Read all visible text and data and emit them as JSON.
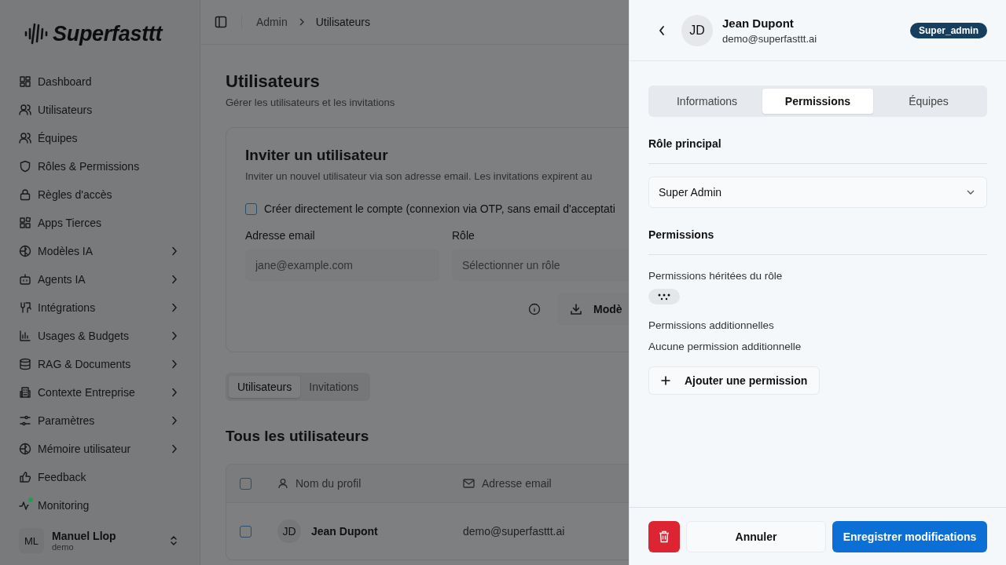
{
  "brand": {
    "name": "Superfasttt"
  },
  "sidebar": {
    "items": [
      {
        "label": "Dashboard",
        "has_submenu": false
      },
      {
        "label": "Utilisateurs",
        "has_submenu": false
      },
      {
        "label": "Équipes",
        "has_submenu": false
      },
      {
        "label": "Rôles & Permissions",
        "has_submenu": false
      },
      {
        "label": "Règles d'accès",
        "has_submenu": false
      },
      {
        "label": "Apps Tierces",
        "has_submenu": false
      },
      {
        "label": "Modèles IA",
        "has_submenu": true
      },
      {
        "label": "Agents IA",
        "has_submenu": true
      },
      {
        "label": "Intégrations",
        "has_submenu": true
      },
      {
        "label": "Usages & Budgets",
        "has_submenu": true
      },
      {
        "label": "RAG & Documents",
        "has_submenu": true
      },
      {
        "label": "Contexte Entreprise",
        "has_submenu": true
      },
      {
        "label": "Paramètres",
        "has_submenu": true
      },
      {
        "label": "Mémoire utilisateur",
        "has_submenu": true
      },
      {
        "label": "Feedback",
        "has_submenu": false
      },
      {
        "label": "Monitoring",
        "has_submenu": false,
        "color": "#1f9d55"
      }
    ],
    "user": {
      "initials": "ML",
      "name": "Manuel Llop",
      "subtitle": "demo"
    }
  },
  "breadcrumb": [
    "Admin",
    "Utilisateurs"
  ],
  "page": {
    "title": "Utilisateurs",
    "subtitle": "Gérer les utilisateurs et les invitations"
  },
  "invite_card": {
    "title": "Inviter un utilisateur",
    "description": "Inviter un nouvel utilisateur via son adresse email. Les invitations expirent au",
    "create_directly": {
      "label": "Créer directement le compte (connexion via OTP, sans email d'acceptati",
      "checked": false
    },
    "email": {
      "label": "Adresse email",
      "placeholder": "jane@example.com"
    },
    "role": {
      "label": "Rôle",
      "placeholder": "Sélectionner un rôle"
    },
    "template_button": "Modè"
  },
  "list_tabs": [
    {
      "label": "Utilisateurs",
      "selected": true
    },
    {
      "label": "Invitations",
      "selected": false
    }
  ],
  "users_section": {
    "title": "Tous les utilisateurs",
    "select_all": false,
    "columns": [
      "Nom du profil",
      "Adresse email"
    ],
    "rows": [
      {
        "initials": "JD",
        "name": "Jean Dupont",
        "email": "demo@superfasttt.ai",
        "selected": false
      }
    ]
  },
  "panel": {
    "initials": "JD",
    "name": "Jean Dupont",
    "email": "demo@superfasttt.ai",
    "badge": "Super_admin",
    "tabs": [
      {
        "label": "Informations",
        "selected": false
      },
      {
        "label": "Permissions",
        "selected": true
      },
      {
        "label": "Équipes",
        "selected": false
      }
    ],
    "role_heading": "Rôle principal",
    "role_value": "Super Admin",
    "permissions_heading": "Permissions",
    "inherited_label": "Permissions héritées du rôle",
    "additional_label": "Permissions additionnelles",
    "no_additional": "Aucune permission additionnelle",
    "add_button": "Ajouter une permission",
    "cancel_button": "Annuler",
    "save_button": "Enregistrer modifications"
  }
}
